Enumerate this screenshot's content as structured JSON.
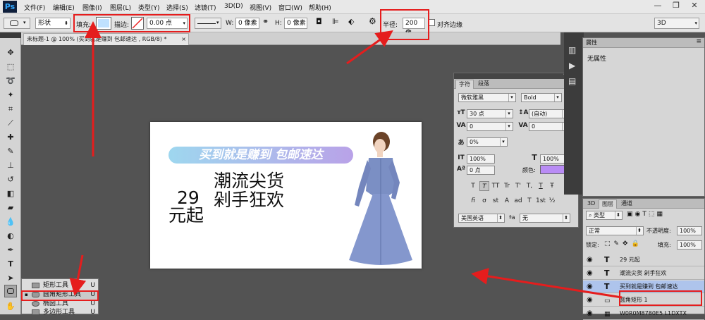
{
  "app": {
    "logo": "Ps"
  },
  "menubar": {
    "items": [
      "文件(F)",
      "编辑(E)",
      "图像(I)",
      "图层(L)",
      "类型(Y)",
      "选择(S)",
      "滤镜(T)",
      "3D(D)",
      "视图(V)",
      "窗口(W)",
      "帮助(H)"
    ]
  },
  "window_controls": {
    "minimize": "—",
    "restore": "❐",
    "close": "✕"
  },
  "options": {
    "mode_label": "形状",
    "fill_label": "填充:",
    "fill_color": "#bfe1ff",
    "stroke_label": "描边:",
    "stroke_width": "0.00 点",
    "w_label": "W:",
    "w_value": "0 像素",
    "h_label": "H:",
    "h_value": "0 像素",
    "radius_label": "半径:",
    "radius_value": "200 像",
    "align_edges": "对齐边缘",
    "workspace": "3D"
  },
  "document": {
    "tab_title": "未标题-1 @ 100% (买到就是赚到 包邮速达 , RGB/8) *"
  },
  "canvas": {
    "banner": "买到就是赚到 包邮速达",
    "line1": "潮流尖货",
    "line2": "剁手狂欢",
    "price": "29",
    "price_suffix": "元起"
  },
  "tool_flyout": {
    "items": [
      {
        "label": "矩形工具",
        "key": "U"
      },
      {
        "label": "圆角矩形工具",
        "key": "U"
      },
      {
        "label": "椭圆工具",
        "key": "U"
      },
      {
        "label": "多边形工具",
        "key": "U"
      }
    ]
  },
  "character_panel": {
    "tab_character": "字符",
    "tab_paragraph": "段落",
    "font_family": "微软雅黑",
    "font_style": "Bold",
    "font_size": "30 点",
    "leading": "(自动)",
    "kerning": "0",
    "tracking": "0",
    "tsume": "0%",
    "vscale": "100%",
    "hscale": "100%",
    "baseline": "0 点",
    "color_label": "颜色:",
    "text_color": "#b98cf5",
    "style_buttons": [
      "T",
      "T",
      "TT",
      "Tr",
      "T'",
      "T,",
      "T",
      "Ŧ"
    ],
    "ot_buttons": [
      "fi",
      "σ",
      "st",
      "A",
      "ad",
      "T",
      "1st",
      "½"
    ],
    "language": "美国英语",
    "aa_label": "ªa",
    "antialias": "无"
  },
  "properties_panel": {
    "title": "属性",
    "content": "无属性"
  },
  "layers_panel": {
    "tabs": [
      "3D",
      "图层",
      "通道"
    ],
    "filter": "类型",
    "blend_mode": "正常",
    "opacity_label": "不透明度:",
    "opacity": "100%",
    "lock_label": "锁定:",
    "fill_label": "填充:",
    "fill": "100%",
    "layers": [
      {
        "name": "29 元起",
        "selected": false
      },
      {
        "name": "潮流尖货 剁手狂欢",
        "selected": false
      },
      {
        "name": "买到就是赚到 包邮速达",
        "selected": true
      },
      {
        "name": "圆角矩形 1",
        "selected": false
      },
      {
        "name": "W0R0M8780E5 L1DXTX",
        "selected": false
      }
    ]
  },
  "colors": {
    "annotation": "#e51d1d",
    "selection": "#aec4ec"
  }
}
